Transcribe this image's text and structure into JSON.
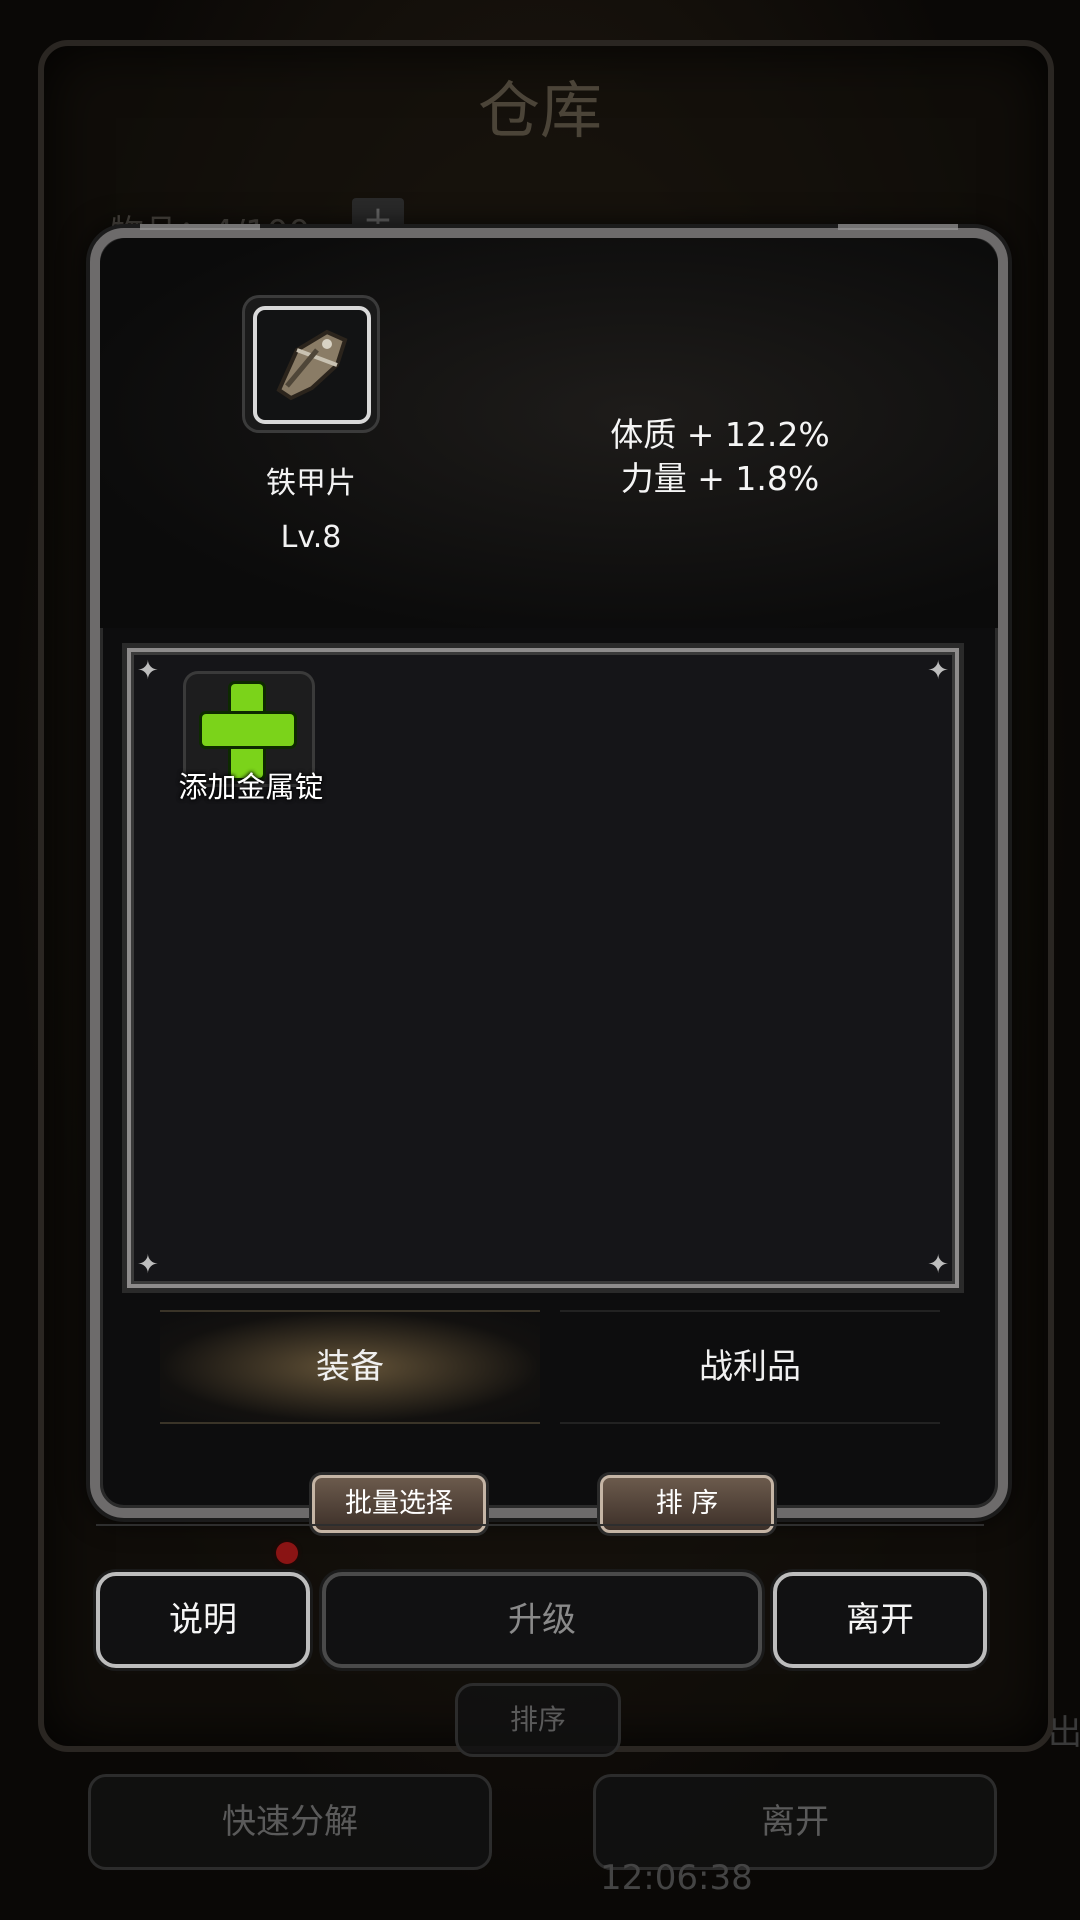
{
  "background": {
    "title": "仓库",
    "capacity": "物品：4/100",
    "plus_label": "+",
    "sort_label": "排序",
    "quick_decompose_label": "快速分解",
    "leave_label": "离开",
    "time": "12:06:38",
    "edge_text": "出"
  },
  "item": {
    "name": "铁甲片",
    "level": "Lv.8",
    "icon": "iron-armor-plate-icon",
    "stats": [
      "体质 + 12.2%",
      "力量 + 1.8%"
    ]
  },
  "slot": {
    "add_label": "添加金属锭",
    "icon": "green-plus-icon",
    "sparkle": "✦"
  },
  "tabs": {
    "equip": "装备",
    "loot": "战利品",
    "active": "equip"
  },
  "controls": {
    "batch_select": "批量选择",
    "sort": "排  序"
  },
  "actions": {
    "help": "说明",
    "upgrade": "升级",
    "leave": "离开"
  },
  "colors": {
    "accent_green": "#7bd31a",
    "frame": "#6d6b6b",
    "notice_dot": "#8a1414"
  }
}
